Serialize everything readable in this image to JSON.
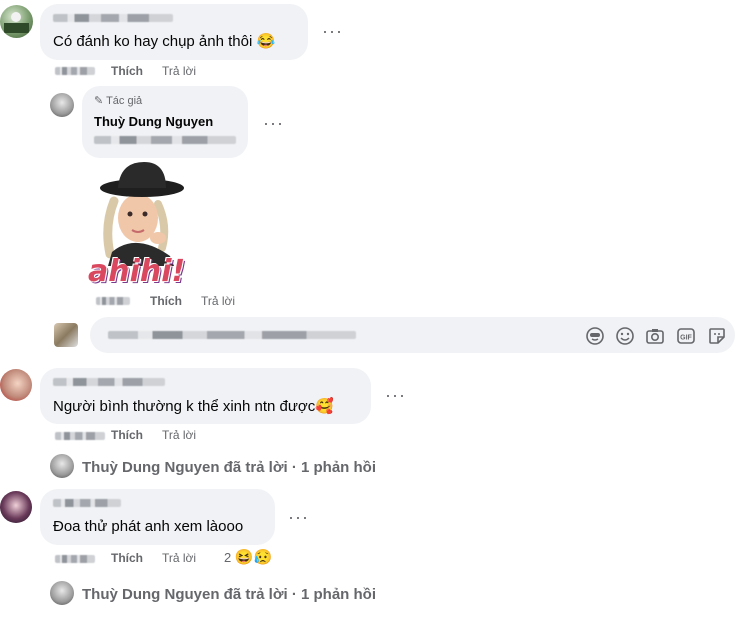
{
  "comment1": {
    "text": "Có đánh ko hay chụp ảnh thôi",
    "emoji": "😂",
    "like": "Thích",
    "reply": "Trả lời"
  },
  "reply1": {
    "badge": "Tác giả",
    "author": "Thuỳ Dung Nguyen",
    "sticker_text": "ahihi!",
    "like": "Thích",
    "reply": "Trả lời"
  },
  "comment2": {
    "text": "Người bình thường k thể xinh ntn được",
    "emoji": "🥰",
    "like": "Thích",
    "reply": "Trả lời",
    "replies_summary": "Thuỳ Dung Nguyen đã trả lời · 1 phản hồi"
  },
  "comment3": {
    "text": "Đoa thử phát anh xem làooo",
    "like": "Thích",
    "reply": "Trả lời",
    "reaction_count": "2",
    "reaction_emojis": "😆😥",
    "replies_summary": "Thuỳ Dung Nguyen đã trả lời · 1 phản hồi"
  },
  "icons": [
    "avatar-sticker-icon",
    "emoji-icon",
    "camera-icon",
    "gif-icon",
    "sticker-icon",
    "pencil-icon"
  ],
  "colors": {
    "bubble": "#f0f2f5",
    "secondary_text": "#65676b",
    "sticker_text": "#d9485f"
  }
}
